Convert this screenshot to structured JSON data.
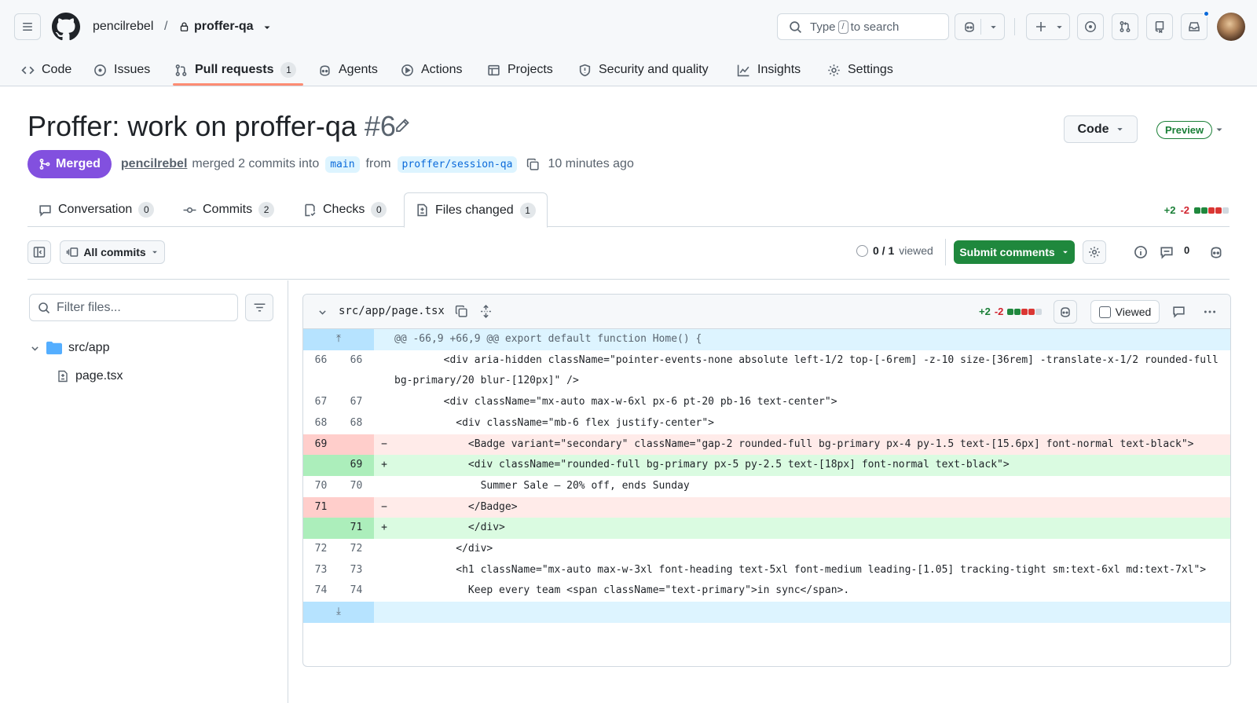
{
  "repo": {
    "owner": "pencilrebel",
    "separator": "/",
    "name": "proffer-qa"
  },
  "search": {
    "prefix": "Type",
    "key": "/",
    "suffix": "to search"
  },
  "nav": [
    {
      "label": "Code"
    },
    {
      "label": "Issues"
    },
    {
      "label": "Pull requests",
      "count": "1"
    },
    {
      "label": "Agents"
    },
    {
      "label": "Actions"
    },
    {
      "label": "Projects"
    },
    {
      "label": "Security and quality"
    },
    {
      "label": "Insights"
    },
    {
      "label": "Settings"
    }
  ],
  "pr": {
    "title": "Proffer: work on proffer-qa",
    "number": "#6",
    "status": "Merged",
    "author": "pencilrebel",
    "action": "merged 2 commits into",
    "base": "main",
    "from": "from",
    "head": "proffer/session-qa",
    "time": "10 minutes ago",
    "code_button": "Code",
    "preview_badge": "Preview"
  },
  "tabs": [
    {
      "label": "Conversation",
      "count": "0"
    },
    {
      "label": "Commits",
      "count": "2"
    },
    {
      "label": "Checks",
      "count": "0"
    },
    {
      "label": "Files changed",
      "count": "1"
    }
  ],
  "diffstat": {
    "additions": "+2",
    "deletions": "-2"
  },
  "toolbar": {
    "all_commits": "All commits",
    "viewed_count": "0 / 1",
    "viewed_label": "viewed",
    "submit": "Submit comments",
    "comments_count": "0"
  },
  "sidebar": {
    "filter_placeholder": "Filter files...",
    "folder": "src/app",
    "file": "page.tsx"
  },
  "diff": {
    "filename": "src/app/page.tsx",
    "additions": "+2",
    "deletions": "-2",
    "viewed_label": "Viewed",
    "hunk": "@@ -66,9 +66,9 @@ export default function Home() {",
    "lines": [
      {
        "type": "ctx",
        "old": "66",
        "new": "66",
        "text": "        <div aria-hidden className=\"pointer-events-none absolute left-1/2 top-[-6rem] -z-10 size-[36rem] -translate-x-1/2 rounded-full bg-primary/20 blur-[120px]\" />"
      },
      {
        "type": "ctx",
        "old": "67",
        "new": "67",
        "text": "        <div className=\"mx-auto max-w-6xl px-6 pt-20 pb-16 text-center\">"
      },
      {
        "type": "ctx",
        "old": "68",
        "new": "68",
        "text": "          <div className=\"mb-6 flex justify-center\">"
      },
      {
        "type": "del",
        "old": "69",
        "new": "",
        "sign": "−",
        "text": "            <Badge variant=\"secondary\" className=\"gap-2 rounded-full bg-primary px-4 py-1.5 text-[15.6px] font-normal text-black\">"
      },
      {
        "type": "ins",
        "old": "",
        "new": "69",
        "sign": "+",
        "text": "            <div className=\"rounded-full bg-primary px-5 py-2.5 text-[18px] font-normal text-black\">"
      },
      {
        "type": "ctx",
        "old": "70",
        "new": "70",
        "text": "              Summer Sale — 20% off, ends Sunday"
      },
      {
        "type": "del",
        "old": "71",
        "new": "",
        "sign": "−",
        "text": "            </Badge>"
      },
      {
        "type": "ins",
        "old": "",
        "new": "71",
        "sign": "+",
        "text": "            </div>"
      },
      {
        "type": "ctx",
        "old": "72",
        "new": "72",
        "text": "          </div>"
      },
      {
        "type": "ctx",
        "old": "73",
        "new": "73",
        "text": "          <h1 className=\"mx-auto max-w-3xl font-heading text-5xl font-medium leading-[1.05] tracking-tight sm:text-6xl md:text-7xl\">"
      },
      {
        "type": "ctx",
        "old": "74",
        "new": "74",
        "text": "            Keep every team <span className=\"text-primary\">in sync</span>."
      }
    ]
  },
  "colors": {
    "merged": "#8250df",
    "accent": "#0969da",
    "success": "#1f883d",
    "danger": "#d1242f"
  }
}
